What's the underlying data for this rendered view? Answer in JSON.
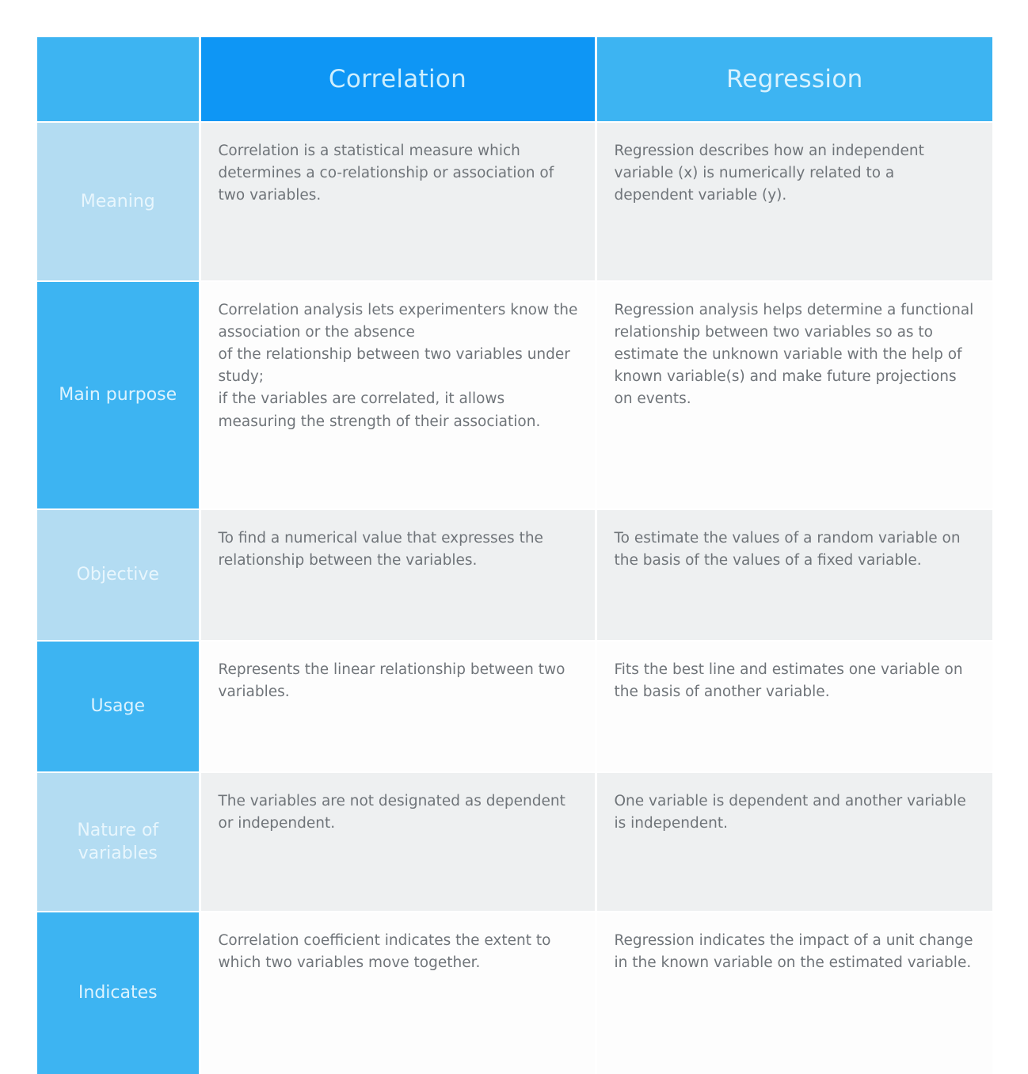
{
  "table": {
    "header": {
      "blank_label": "",
      "columns": [
        "Correlation",
        "Regression"
      ]
    },
    "colors": {
      "header_blank": "#3db4f2",
      "header_correlation": "#0e96f5",
      "header_regression": "#3db4f2",
      "label_pale": "#b3dcf2",
      "label_vivid": "#3db4f2",
      "cell_grey": "#eef0f1",
      "cell_white": "#fdfdfd",
      "body_text": "#6f7479",
      "page_background": "#ffffff"
    },
    "rows": [
      {
        "label": "Meaning",
        "correlation": "Correlation is a statistical measure which determines a co-relationship or association of two variables.",
        "regression": "Regression describes how an independent variable (x) is numerically related to a dependent variable (y)."
      },
      {
        "label": "Main purpose",
        "correlation": "Correlation analysis lets experimenters know the association or the absence\nof the relationship between two variables under study;\nif the variables are correlated, it allows measuring the strength of their association.",
        "regression": "Regression analysis helps determine a functional relationship between two variables so as to estimate the unknown variable with the help of known variable(s) and make future projections on events."
      },
      {
        "label": "Objective",
        "correlation": "To find a numerical value that expresses the relationship between the variables.",
        "regression": "To estimate the values of a random variable on the basis of the values of a fixed variable."
      },
      {
        "label": "Usage",
        "correlation": "Represents the linear relationship between two variables.",
        "regression": "Fits the best line and estimates one variable on the basis of another variable."
      },
      {
        "label": "Nature of\nvariables",
        "correlation": "The variables are not designated as dependent or independent.",
        "regression": "One variable is dependent and another variable is independent."
      },
      {
        "label": "Indicates",
        "correlation": "Correlation coefficient indicates the extent to which two variables move together.",
        "regression": "Regression indicates the impact of a unit change in the known variable on the estimated variable."
      }
    ]
  }
}
